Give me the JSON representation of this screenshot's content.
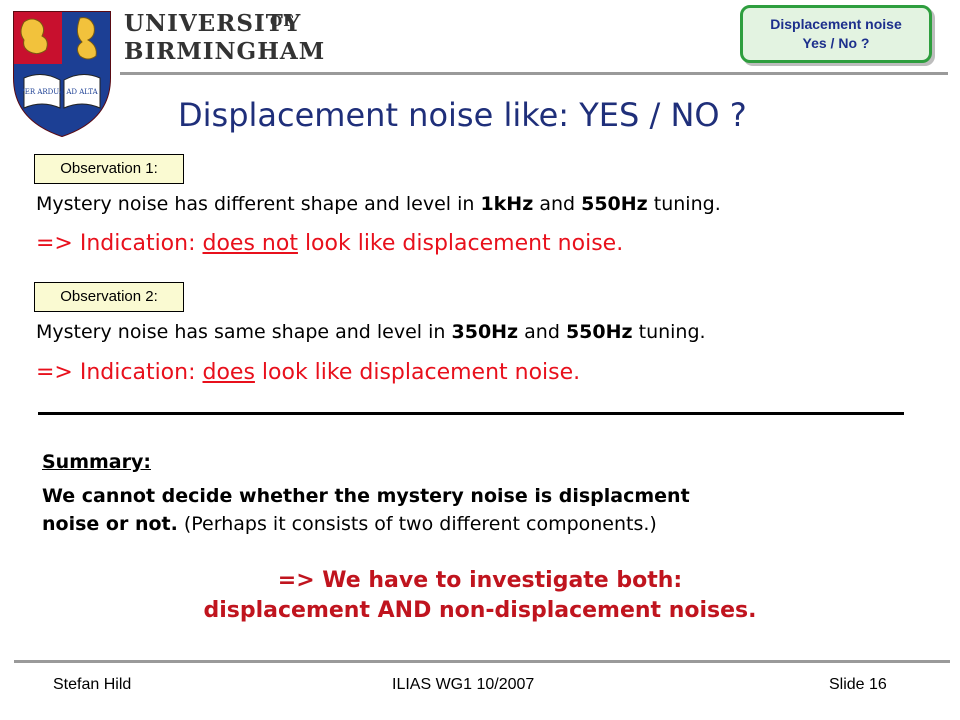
{
  "header": {
    "university_line1": "UNIVERSITY",
    "university_of": "OF",
    "university_line2": "BIRMINGHAM",
    "crest_book_left": "PER ARDUA",
    "crest_book_right": "AD ALTA"
  },
  "badge": {
    "line1": "Displacement noise",
    "line2": "Yes / No ?"
  },
  "title": "Displacement noise like: YES / NO ?",
  "observation1": {
    "label": "Observation 1:",
    "text_a": "Mystery noise has different shape and level in ",
    "bold_a": "1kHz",
    "text_b": " and ",
    "bold_b": "550Hz",
    "text_c": " tuning.",
    "ind_prefix": "=> Indication: ",
    "ind_underlined": "does not",
    "ind_suffix": " look like displacement noise."
  },
  "observation2": {
    "label": "Observation 2:",
    "text_a": "Mystery noise has same shape and level in ",
    "bold_a": "350Hz",
    "text_b": " and ",
    "bold_b": "550Hz",
    "text_c": " tuning.",
    "ind_prefix": "=> Indication: ",
    "ind_underlined": "does",
    "ind_suffix": " look like displacement noise."
  },
  "summary": {
    "heading": "Summary:",
    "line1": "We cannot decide whether the mystery noise is displacment",
    "line2_bold": "noise or not.",
    "line2_rest": " (Perhaps it consists of two different components.)",
    "conclusion1": "=> We have to investigate both:",
    "conclusion2": "displacement AND non-displacement noises."
  },
  "footer": {
    "left": "Stefan Hild",
    "center": "ILIAS WG1 10/2007",
    "right": "Slide 16"
  },
  "colors": {
    "title": "#1f2f7a",
    "red": "#e8101c",
    "badge_border": "#2e9e3e",
    "badge_fill": "#e3f3e1",
    "obs_fill": "#fafad2"
  }
}
